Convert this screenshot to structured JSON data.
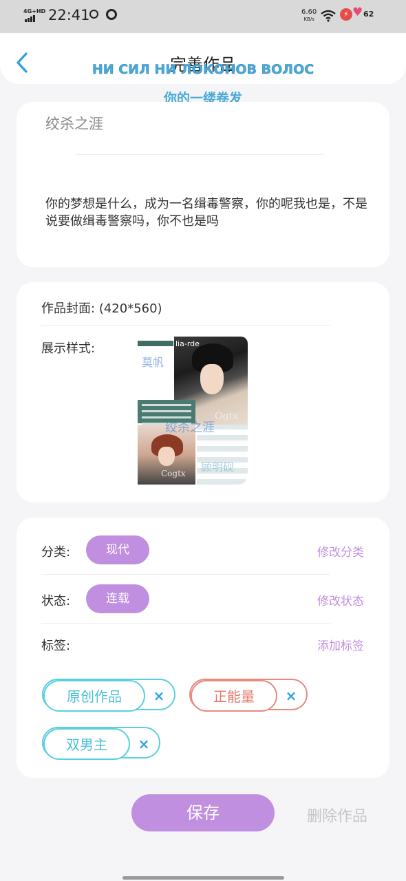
{
  "status_bar": {
    "network": "4G+HD",
    "time": "22:41",
    "speed_value": "6.60",
    "speed_unit": "KB/s",
    "battery": "62"
  },
  "header": {
    "title": "完善作品",
    "overlay_line1": "НИ СИЛ НИ ЛОКОНОВ ВОЛОС",
    "overlay_line2": "你的一缕卷发"
  },
  "work": {
    "title": "绞杀之涯",
    "description": "你的梦想是什么，成为一名缉毒警察，你的呢我也是，不是说要做缉毒警察吗，你不也是吗"
  },
  "cover": {
    "label": "作品封面:",
    "size": "(420*560)",
    "display_label": "展示样式:",
    "image_texts": {
      "top_tag": "lia-rde",
      "watermark_1": "莫帆",
      "watermark_2": "绞杀之涯",
      "watermark_3": "顾明砚",
      "watermark_4": "Ogtx",
      "watermark_5": "Cogtx"
    }
  },
  "meta": {
    "category_label": "分类:",
    "category_value": "现代",
    "category_action": "修改分类",
    "status_label": "状态:",
    "status_value": "连载",
    "status_action": "修改状态",
    "tags_label": "标签:",
    "tags_action": "添加标签",
    "tags": [
      {
        "text": "原创作品",
        "remove": "×"
      },
      {
        "text": "正能量",
        "remove": "×"
      },
      {
        "text": "双男主",
        "remove": "×"
      }
    ]
  },
  "footer": {
    "save": "保存",
    "delete": "删除作品"
  },
  "colors": {
    "accent": "#c08fe0",
    "tag_cyan": "#5ccfdf",
    "tag_red": "#e88a7d",
    "remove_icon": "#2ea4e0",
    "back_icon": "#2e9fe0"
  }
}
